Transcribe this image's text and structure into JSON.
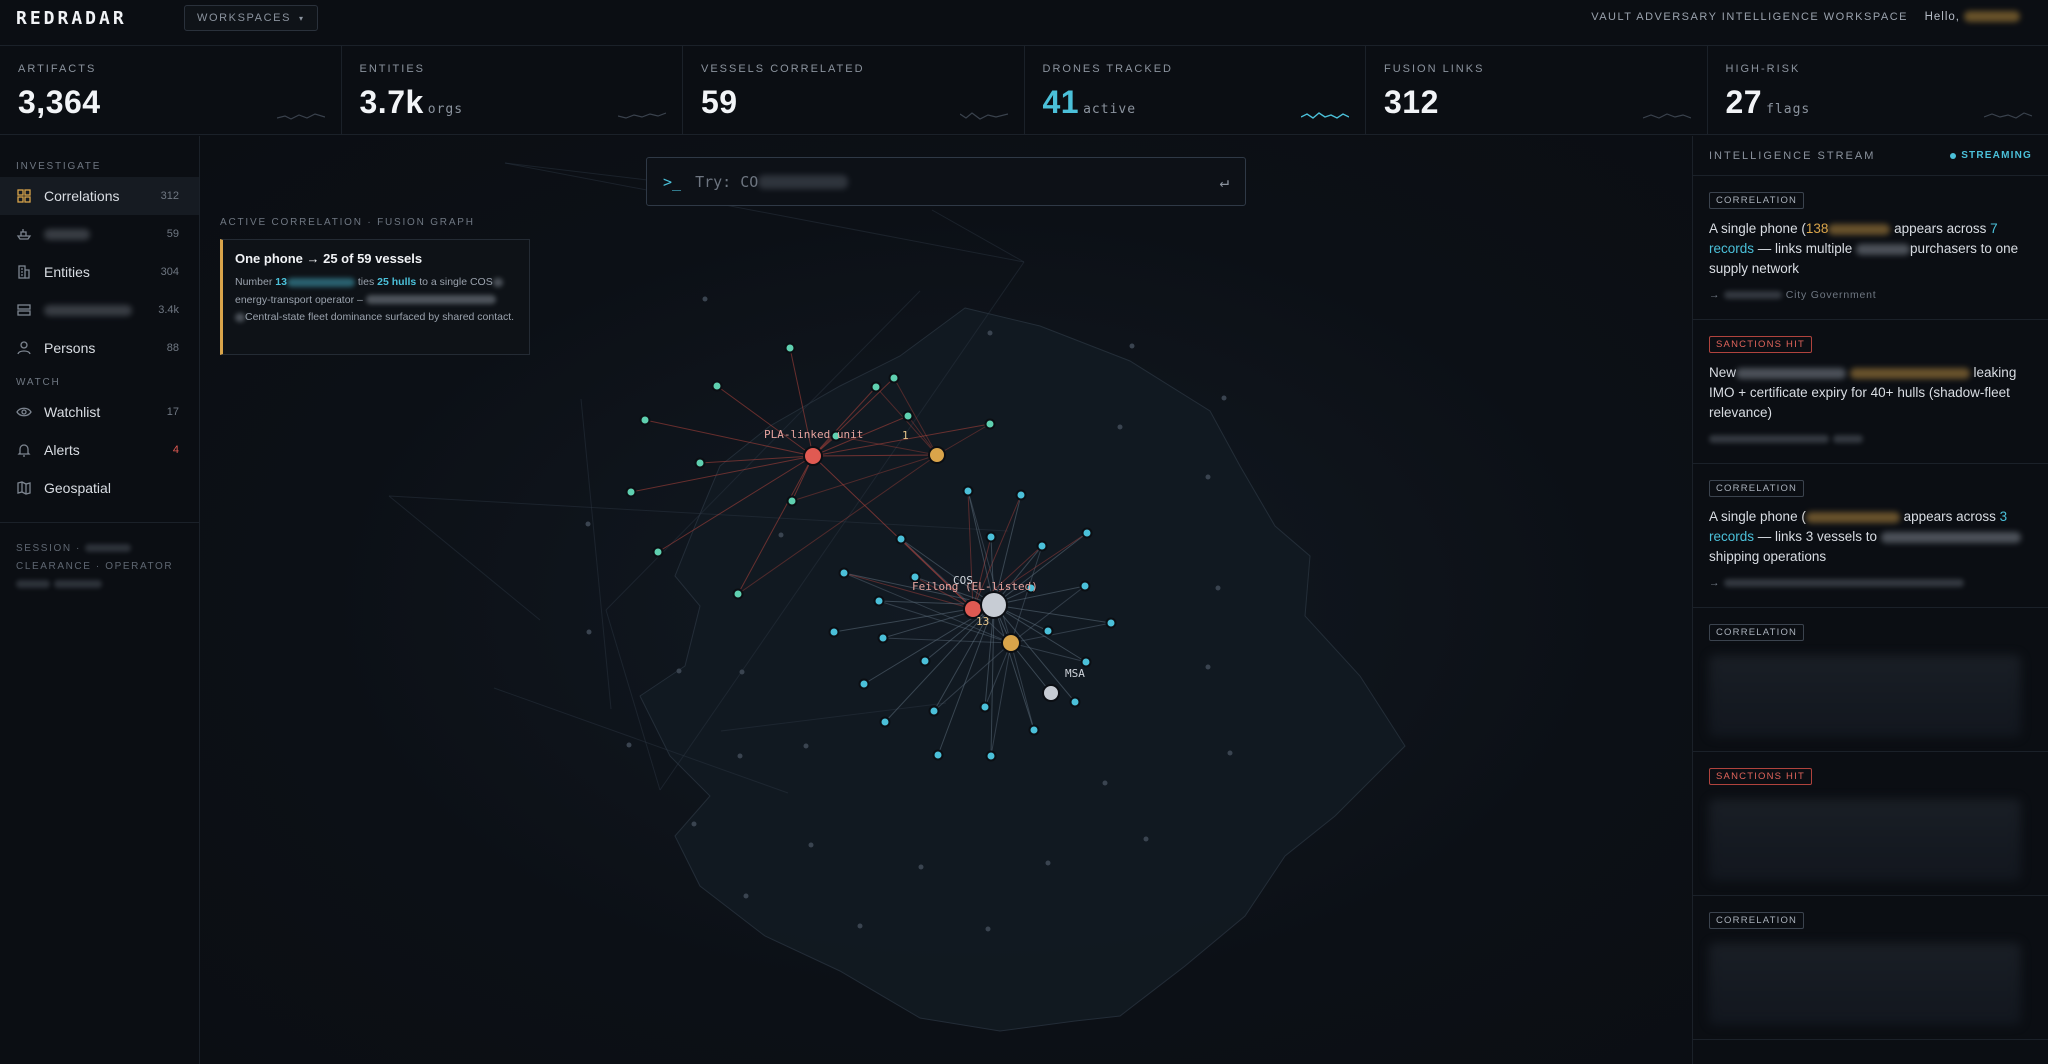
{
  "app": {
    "logo": "REDRADAR",
    "workspaces_label": "WORKSPACES",
    "workspace_title": "VAULT ADVERSARY INTELLIGENCE WORKSPACE",
    "greeting": "Hello,"
  },
  "stats": [
    {
      "label": "ARTIFACTS",
      "value": "3,364",
      "unit": ""
    },
    {
      "label": "ENTITIES",
      "value": "3.7k",
      "unit": "orgs"
    },
    {
      "label": "VESSELS CORRELATED",
      "value": "59",
      "unit": ""
    },
    {
      "label": "DRONES TRACKED",
      "value": "41",
      "unit": "active"
    },
    {
      "label": "FUSION LINKS",
      "value": "312",
      "unit": ""
    },
    {
      "label": "HIGH-RISK",
      "value": "27",
      "unit": "flags"
    }
  ],
  "sidebar": {
    "investigate_label": "INVESTIGATE",
    "watch_label": "WATCH",
    "items": [
      {
        "label": "Correlations",
        "count": "312",
        "icon": "grid-icon"
      },
      {
        "label": "",
        "count": "59",
        "icon": "ship-icon"
      },
      {
        "label": "Entities",
        "count": "304",
        "icon": "building-icon"
      },
      {
        "label": "",
        "count": "3.4k",
        "icon": "database-icon"
      },
      {
        "label": "Persons",
        "count": "88",
        "icon": "person-icon"
      }
    ],
    "watch_items": [
      {
        "label": "Watchlist",
        "count": "17",
        "icon": "eye-icon"
      },
      {
        "label": "Alerts",
        "count": "4",
        "icon": "bell-icon"
      },
      {
        "label": "Geospatial",
        "count": "",
        "icon": "map-icon"
      }
    ],
    "session_label": "SESSION ·",
    "clearance_label": "CLEARANCE · OPERATOR"
  },
  "search": {
    "prompt": ">_",
    "placeholder": "Try: CO",
    "enter_icon": "return-icon"
  },
  "correlation": {
    "section_label": "ACTIVE CORRELATION · FUSION GRAPH",
    "title": "One phone → 25 of 59 vessels",
    "line1_a": "Number",
    "line1_num": "13",
    "line1_b": "ties",
    "line1_hulls": "25 hulls",
    "line1_c": "to a single COS",
    "line2": "energy-transport operator –",
    "line3": "Central-state fleet dominance surfaced by shared contact."
  },
  "graph": {
    "labels": {
      "pla": "PLA-linked unit",
      "feilong": "Feilong (EL-listed)",
      "cos": "COS",
      "n1": "13",
      "n2": "1",
      "msa": "MSA"
    },
    "colors": {
      "red": "#e05a52",
      "amber": "#d9a44a",
      "cyan": "#4bc0d9",
      "teal": "#5fd0b0",
      "white": "#c7ccd4"
    }
  },
  "stream": {
    "title": "INTELLIGENCE STREAM",
    "status": "STREAMING",
    "cards": [
      {
        "badge": "CORRELATION",
        "type": "correlation",
        "t1": "A single phone (",
        "t1_num": "138",
        "t2": " appears across ",
        "t2_hl": "7 records",
        "t3": " — links multiple ",
        "t4": "purchasers to one supply network",
        "foot": "City Government"
      },
      {
        "badge": "SANCTIONS HIT",
        "type": "sanction",
        "t1": "New",
        "t2": "leaking IMO + certificate expiry for 40+ hulls (shadow-fleet relevance)"
      },
      {
        "badge": "CORRELATION",
        "type": "correlation",
        "t1": "A single phone (",
        "t2": " appears across ",
        "t2_hl": "3 records",
        "t3": " — links 3 vessels to ",
        "t4": "shipping operations"
      },
      {
        "badge": "CORRELATION",
        "type": "correlation"
      },
      {
        "badge": "SANCTIONS HIT",
        "type": "sanction"
      },
      {
        "badge": "CORRELATION",
        "type": "correlation"
      }
    ]
  }
}
